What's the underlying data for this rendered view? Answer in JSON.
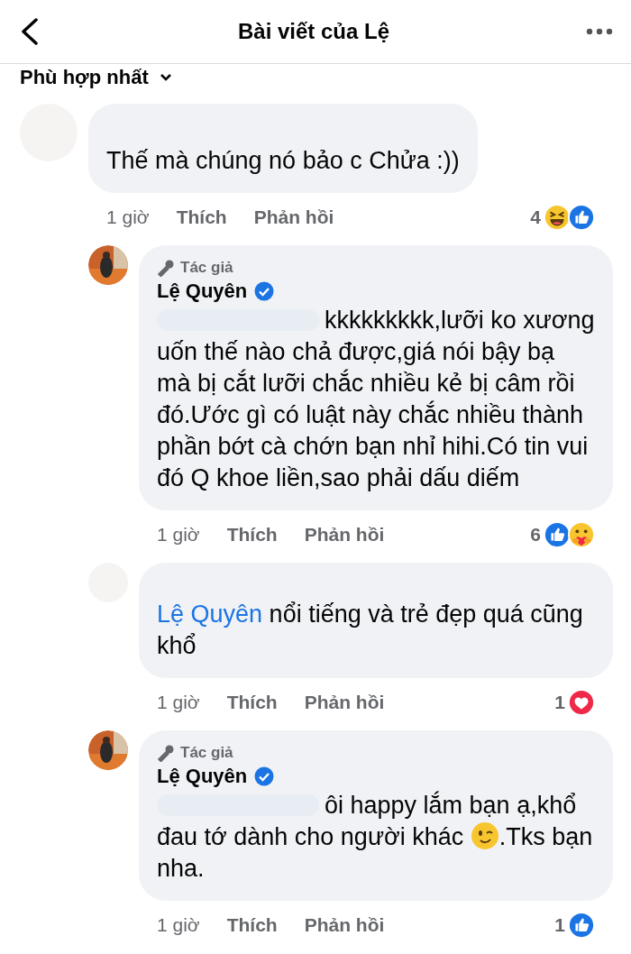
{
  "header": {
    "title": "Bài viết của Lệ"
  },
  "sort": {
    "label": "Phù hợp nhất"
  },
  "comments": [
    {
      "kind": "comment",
      "text": "Thế mà chúng nó bảo c Chửa :))",
      "time": "1 giờ",
      "like": "Thích",
      "reply": "Phản hồi",
      "reaction_count": "4",
      "reactions": [
        {
          "kind": "haha"
        },
        {
          "kind": "like"
        }
      ]
    },
    {
      "kind": "reply",
      "badge": "Tác giả",
      "author": "Lệ Quyên",
      "verified": true,
      "hidden_mention": true,
      "text": "kkkkkkkkk,lưỡi ko xương uốn thế nào chả được,giá nói bậy bạ mà bị cắt lưỡi chắc nhiều kẻ bị câm rồi đó.Ước gì có luật này chắc nhiều thành phần bớt cà chớn bạn nhỉ hihi.Có tin vui đó Q khoe liền,sao phải dấu diếm",
      "time": "1 giờ",
      "like": "Thích",
      "reply": "Phản hồi",
      "reaction_count": "6",
      "reactions": [
        {
          "kind": "like"
        },
        {
          "kind": "care"
        }
      ]
    },
    {
      "kind": "reply_other",
      "mention": "Lệ Quyên",
      "text": "nổi tiếng và trẻ đẹp quá cũng khổ",
      "time": "1 giờ",
      "like": "Thích",
      "reply": "Phản hồi",
      "reaction_count": "1",
      "reactions": [
        {
          "kind": "love"
        }
      ]
    },
    {
      "kind": "reply",
      "badge": "Tác giả",
      "author": "Lệ Quyên",
      "verified": true,
      "hidden_mention": true,
      "text": "ôi happy lắm bạn ạ,khổ đau tớ dành cho người khác",
      "emoji": {
        "kind": "wink"
      },
      "text_after": ".Tks bạn nha.",
      "time": "1 giờ",
      "like": "Thích",
      "reply": "Phản hồi",
      "reaction_count": "1",
      "reactions": [
        {
          "kind": "like"
        }
      ]
    }
  ]
}
